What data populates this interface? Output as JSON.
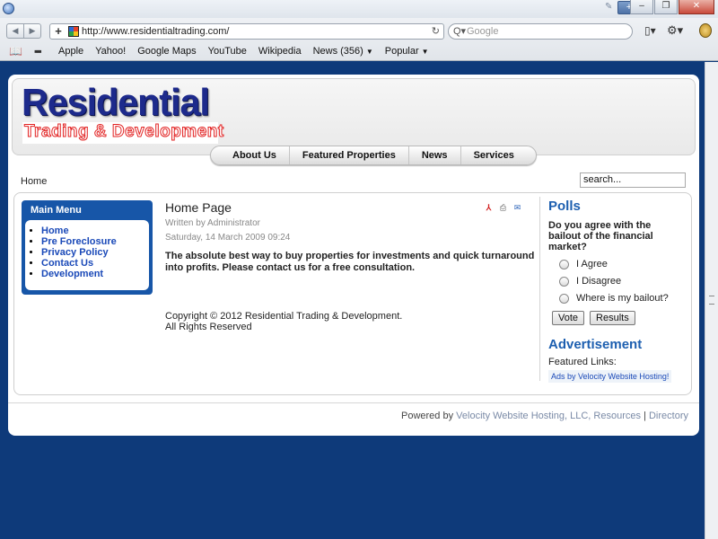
{
  "browser": {
    "url": "http://www.residentialtrading.com/",
    "search_placeholder": "Google",
    "bookmarks": [
      "Apple",
      "Yahoo!",
      "Google Maps",
      "YouTube",
      "Wikipedia",
      "News (356)",
      "Popular"
    ]
  },
  "site": {
    "logo_main": "Residential",
    "logo_sub": "Trading & Development",
    "menu": [
      "About Us",
      "Featured Properties",
      "News",
      "Services"
    ],
    "breadcrumb": "Home",
    "search_value": "search...",
    "main_menu": {
      "title": "Main Menu",
      "items": [
        "Home",
        "Pre Foreclosure",
        "Privacy Policy",
        "Contact Us",
        "Development"
      ]
    },
    "article": {
      "title": "Home Page",
      "author": "Written by Administrator",
      "date": "Saturday, 14 March 2009 09:24",
      "body": "The absolute best way to buy properties for investments and quick turnaround into profits. Please contact us for a free consultation.",
      "copyright_line1": "Copyright © 2012 Residential Trading & Development.",
      "copyright_line2": "All Rights Reserved"
    },
    "polls": {
      "title": "Polls",
      "question": "Do you agree with the bailout of the financial market?",
      "options": [
        "I Agree",
        "I Disagree",
        "Where is my bailout?"
      ],
      "vote_label": "Vote",
      "results_label": "Results"
    },
    "advertisement": {
      "title": "Advertisement",
      "featured_label": "Featured Links:",
      "link_text": "Ads by Velocity Website Hosting!"
    },
    "footer": {
      "powered_by": "Powered by",
      "host_link": "Velocity Website Hosting, LLC, Resources",
      "separator": "|",
      "directory_link": "Directory"
    }
  },
  "colors": {
    "background": "#0e3a7a",
    "menu_blue": "#1756a8",
    "heading_blue": "#1d5fb0",
    "logo_red": "#e22222"
  }
}
